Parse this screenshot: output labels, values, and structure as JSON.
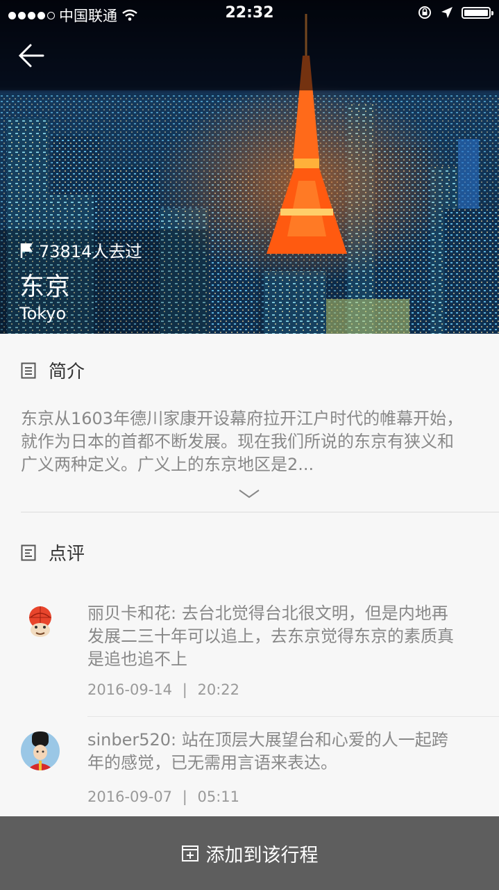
{
  "status_bar": {
    "carrier": "中国联通",
    "time": "22:32",
    "signal_icon": "signal-dots-icon",
    "wifi_icon": "wifi-icon",
    "rotation_lock_icon": "rotation-lock-icon",
    "location_icon": "location-arrow-icon",
    "battery_icon": "battery-icon"
  },
  "hero": {
    "visits": "73814人去过",
    "city_cn": "东京",
    "city_en": "Tokyo",
    "back_icon": "back-arrow-icon",
    "flag_icon": "flag-icon"
  },
  "intro": {
    "title": "简介",
    "text": "东京从1603年德川家康开设幕府拉开江户时代的帷幕开始，就作为日本的首都不断发展。现在我们所说的东京有狭义和广义两种定义。广义上的东京地区是2...",
    "expand_icon": "chevron-down-icon"
  },
  "reviews": {
    "title": "点评",
    "items": [
      {
        "text": "丽贝卡和花: 去台北觉得台北很文明，但是内地再发展二三十年可以追上，去东京觉得东京的素质真是追也追不上",
        "date": "2016-09-14",
        "time": "20:22",
        "separator": "|"
      },
      {
        "text": "sinber520: 站在顶层大展望台和心爱的人一起跨年的感觉，已无需用言语来表达。",
        "date": "2016-09-07",
        "time": "05:11",
        "separator": "|"
      }
    ]
  },
  "bottom_bar": {
    "label": "添加到该行程",
    "icon": "add-box-icon"
  },
  "colors": {
    "bottom_bar": "#5e5e5e",
    "background": "#f7f7f7",
    "tower": "#ff6a1a"
  }
}
